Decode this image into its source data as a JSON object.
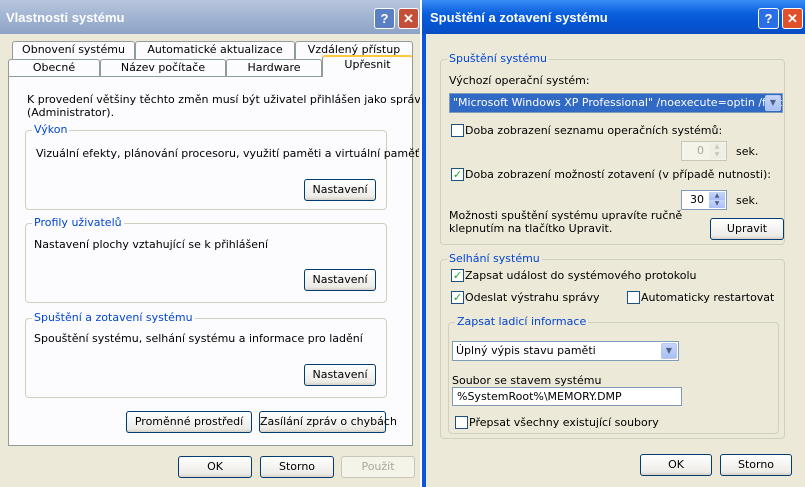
{
  "left_window": {
    "title": "Vlastnosti systému",
    "help_glyph": "?",
    "close_glyph": "✕",
    "tabs_row1": [
      "Obnovení systému",
      "Automatické aktualizace",
      "Vzdálený přístup"
    ],
    "tabs_row2": [
      "Obecné",
      "Název počítače",
      "Hardware",
      "Upřesnit"
    ],
    "intro": "K provedení většiny těchto změn musí být uživatel přihlášen jako správce",
    "intro2": "(Administrator).",
    "groups": [
      {
        "title": "Výkon",
        "text": "Vizuální efekty, plánování procesoru, využití paměti a virtuální paměť",
        "button": "Nastavení"
      },
      {
        "title": "Profily uživatelů",
        "text": "Nastavení plochy vztahující se k přihlášení",
        "button": "Nastavení"
      },
      {
        "title": "Spuštění a zotavení systému",
        "text": "Spouštění systému, selhání systému a informace pro ladění",
        "button": "Nastavení"
      }
    ],
    "env_button": "Proměnné prostředí",
    "error_button": "Zasílání zpráv o chybách",
    "ok": "OK",
    "cancel": "Storno",
    "apply": "Použít"
  },
  "right_window": {
    "title": "Spuštění a zotavení systému",
    "help_glyph": "?",
    "close_glyph": "✕",
    "startup": {
      "title": "Spuštění systému",
      "default_os_label": "Výchozí operační systém:",
      "default_os_value": "\"Microsoft Windows XP Professional\" /noexecute=optin /fastdete",
      "list_time_label": "Doba zobrazení seznamu operačních systémů:",
      "list_time_checked": false,
      "list_time_value": "0",
      "recovery_time_label": "Doba zobrazení možností zotavení (v případě nutnosti):",
      "recovery_time_checked": true,
      "recovery_time_value": "30",
      "sec": "sek.",
      "edit_hint1": "Možnosti spuštění systému upravíte ručně",
      "edit_hint2": "klepnutím na tlačítko Upravit.",
      "edit_button": "Upravit"
    },
    "failure": {
      "title": "Selhání systému",
      "log_label": "Zapsat událost do systémového protokolu",
      "log_checked": true,
      "alert_label": "Odeslat výstrahu správy",
      "alert_checked": true,
      "restart_label": "Automaticky restartovat",
      "restart_checked": false,
      "debug": {
        "title": "Zapsat ladicí informace",
        "dump_value": "Úplný výpis stavu paměti",
        "file_label": "Soubor se stavem systému",
        "file_value": "%SystemRoot%\\MEMORY.DMP",
        "overwrite_label": "Přepsat všechny existující soubory",
        "overwrite_checked": false
      }
    },
    "ok": "OK",
    "cancel": "Storno"
  }
}
